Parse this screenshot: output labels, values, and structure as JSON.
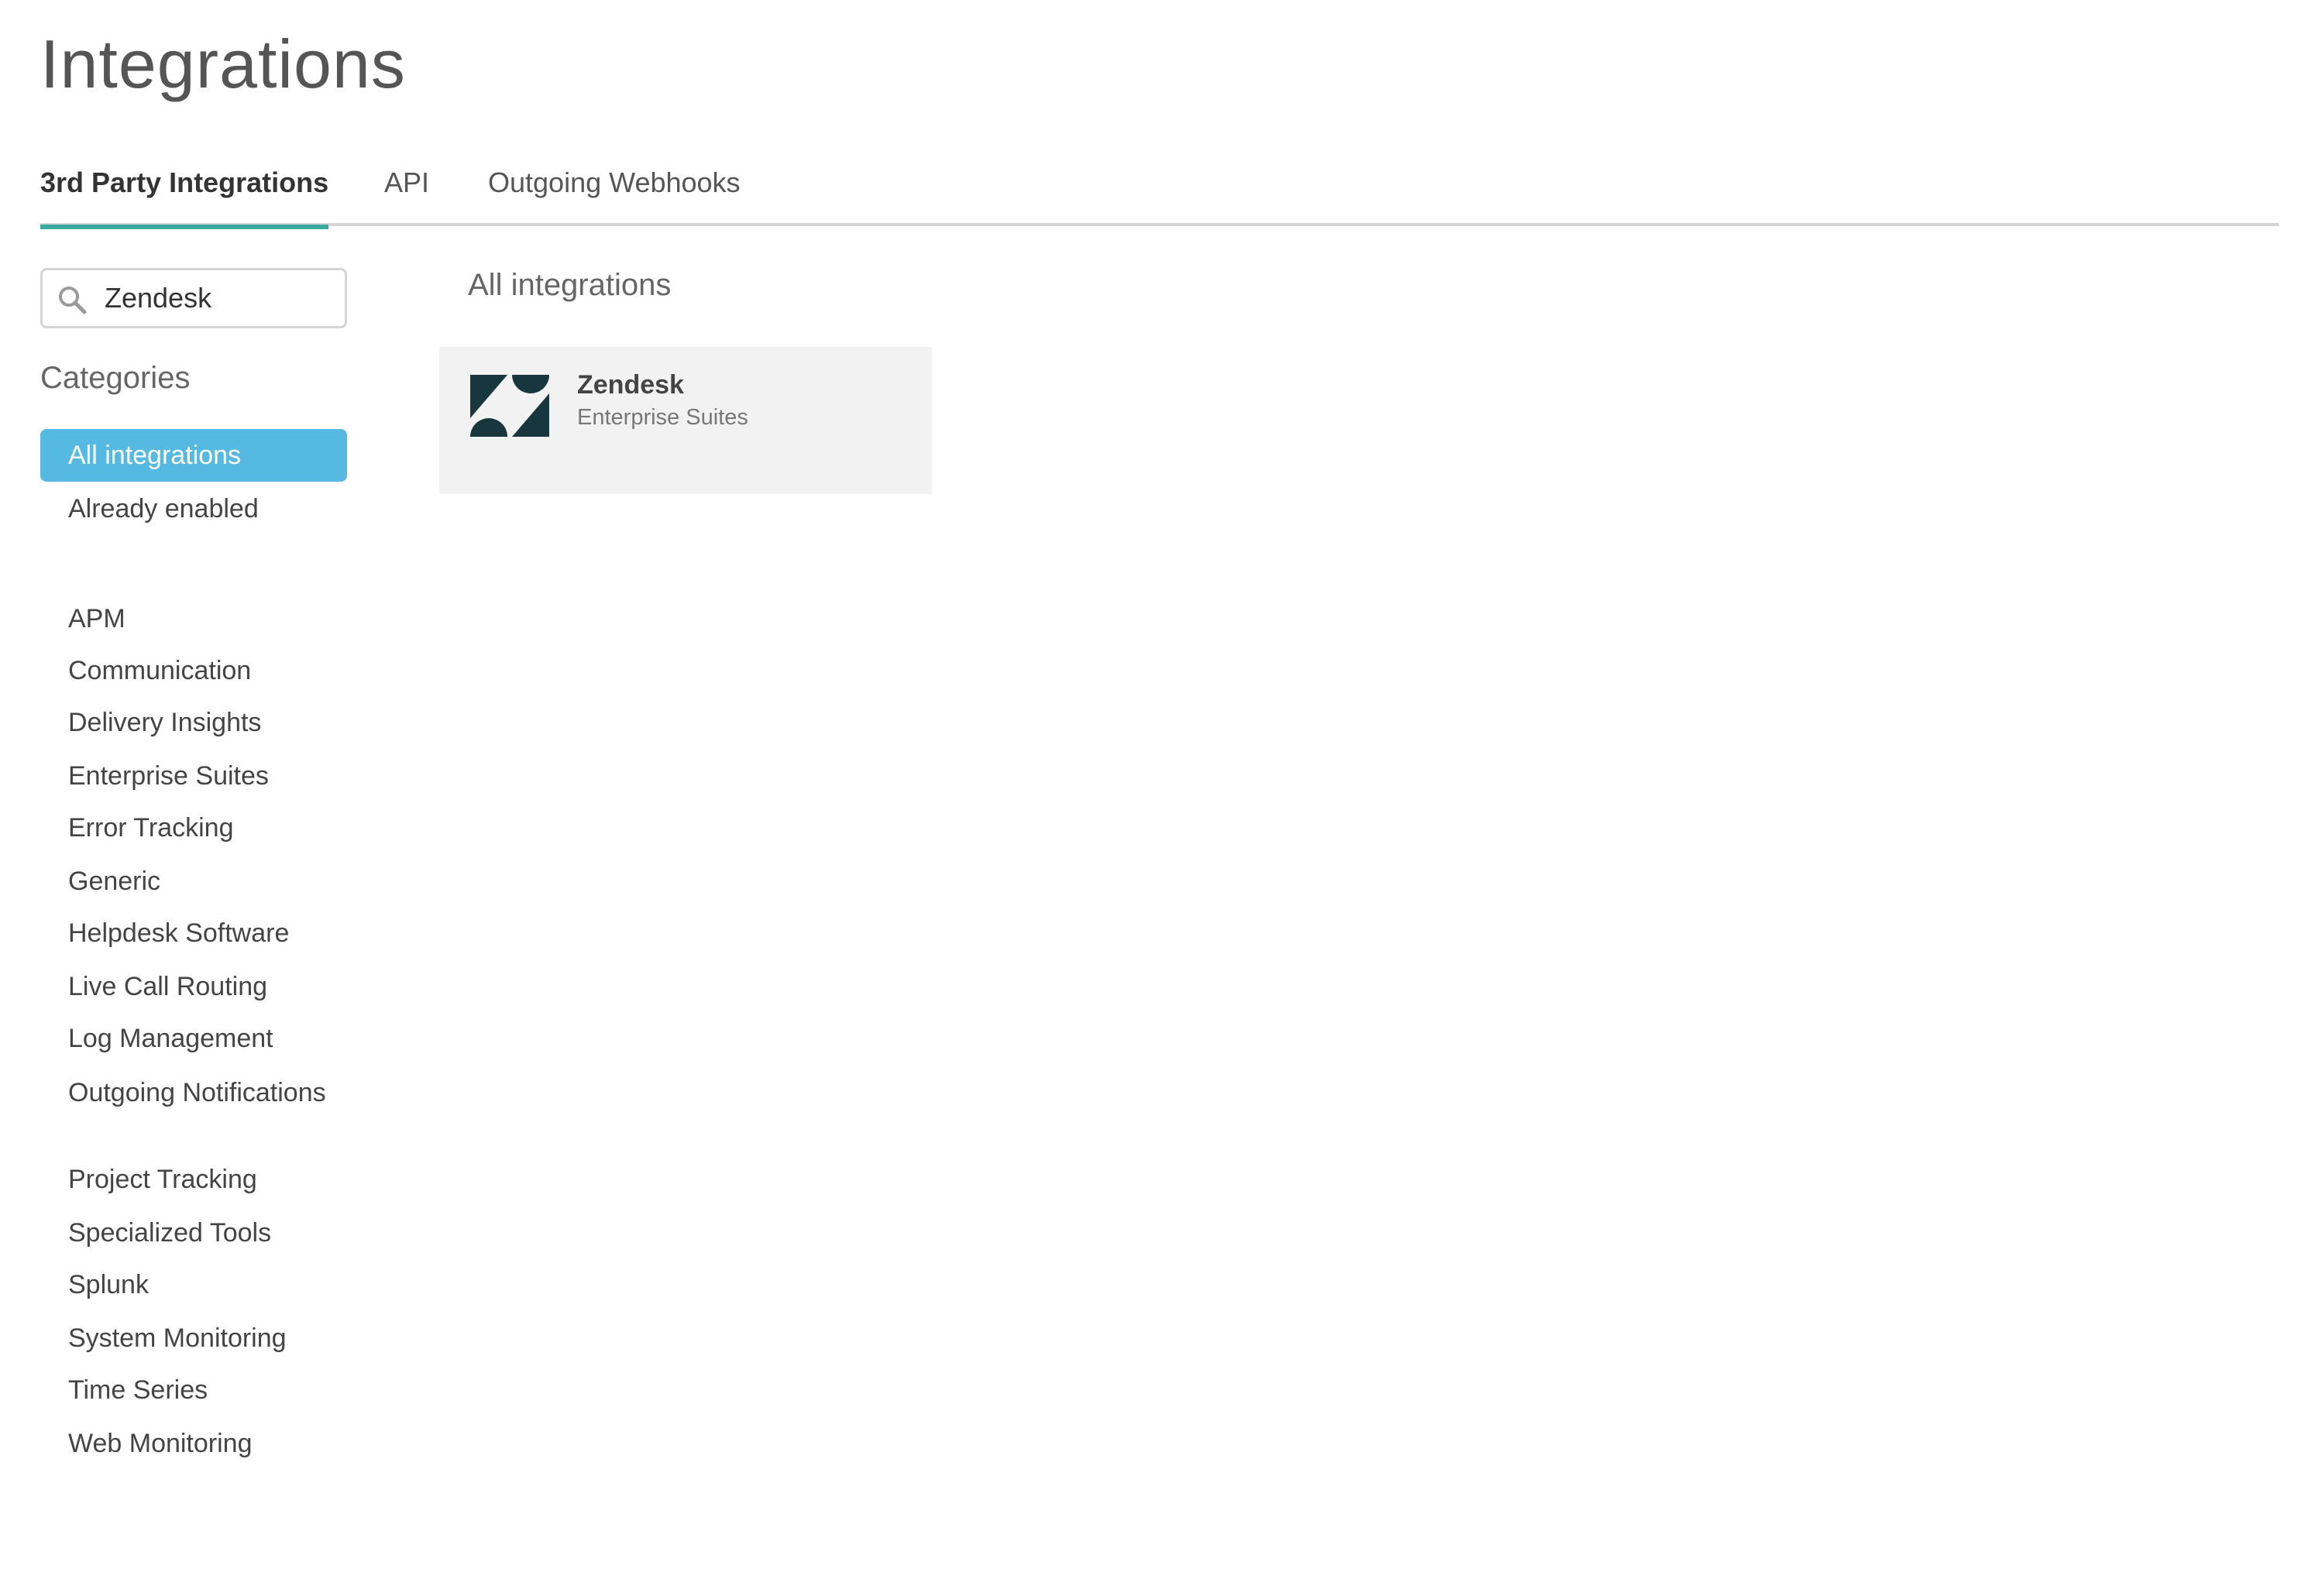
{
  "page": {
    "title": "Integrations"
  },
  "tabs": [
    {
      "label": "3rd Party Integrations",
      "active": true
    },
    {
      "label": "API",
      "active": false
    },
    {
      "label": "Outgoing Webhooks",
      "active": false
    }
  ],
  "search": {
    "icon": "search-icon",
    "value": "Zendesk"
  },
  "sidebar": {
    "heading": "Categories",
    "filters": [
      {
        "label": "All integrations",
        "selected": true
      },
      {
        "label": "Already enabled",
        "selected": false
      }
    ],
    "categories": [
      {
        "label": "APM"
      },
      {
        "label": "Communication"
      },
      {
        "label": "Delivery Insights"
      },
      {
        "label": "Enterprise Suites"
      },
      {
        "label": "Error Tracking"
      },
      {
        "label": "Generic"
      },
      {
        "label": "Helpdesk Software"
      },
      {
        "label": "Live Call Routing"
      },
      {
        "label": "Log Management"
      },
      {
        "label": "Outgoing Notifications"
      },
      {
        "label": "Project Tracking"
      },
      {
        "label": "Specialized Tools"
      },
      {
        "label": "Splunk"
      },
      {
        "label": "System Monitoring"
      },
      {
        "label": "Time Series"
      },
      {
        "label": "Web Monitoring"
      }
    ]
  },
  "main": {
    "heading": "All integrations",
    "results": [
      {
        "name": "Zendesk",
        "category": "Enterprise Suites",
        "icon": "zendesk-logo-icon"
      }
    ]
  },
  "colors": {
    "accent_tab_underline": "#3aa99f",
    "selected_category": "#55b9e1",
    "card_background": "#f2f2f2",
    "zendesk_logo": "#17363d"
  }
}
